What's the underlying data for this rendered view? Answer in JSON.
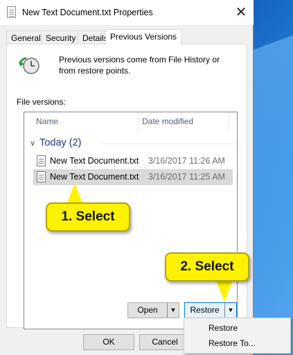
{
  "window": {
    "title": "New Text Document.txt Properties",
    "close_glyph": "✕"
  },
  "tabs": [
    {
      "label": "General",
      "active": false
    },
    {
      "label": "Security",
      "active": false
    },
    {
      "label": "Details",
      "active": false
    },
    {
      "label": "Previous Versions",
      "active": true
    }
  ],
  "info_text": "Previous versions come from File History or from restore points.",
  "file_versions_label": "File versions:",
  "columns": {
    "name": "Name",
    "date": "Date modified"
  },
  "group": {
    "label": "Today (2)"
  },
  "rows": [
    {
      "name": "New Text Document.txt",
      "date": "3/16/2017 11:26 AM",
      "selected": false
    },
    {
      "name": "New Text Document.txt",
      "date": "3/16/2017 11:25 AM",
      "selected": true
    }
  ],
  "buttons": {
    "open": "Open",
    "restore": "Restore",
    "ok": "OK",
    "cancel": "Cancel"
  },
  "menu": [
    "Restore",
    "Restore To..."
  ],
  "callouts": [
    "1. Select",
    "2. Select"
  ],
  "icons": {
    "document": "document-icon",
    "history": "restore-clock-icon",
    "dropdown": "▼"
  },
  "colors": {
    "callout": "#fff200",
    "selection": "#d9d9d9",
    "group_text": "#1e3287",
    "desktop": "#1565c0"
  }
}
